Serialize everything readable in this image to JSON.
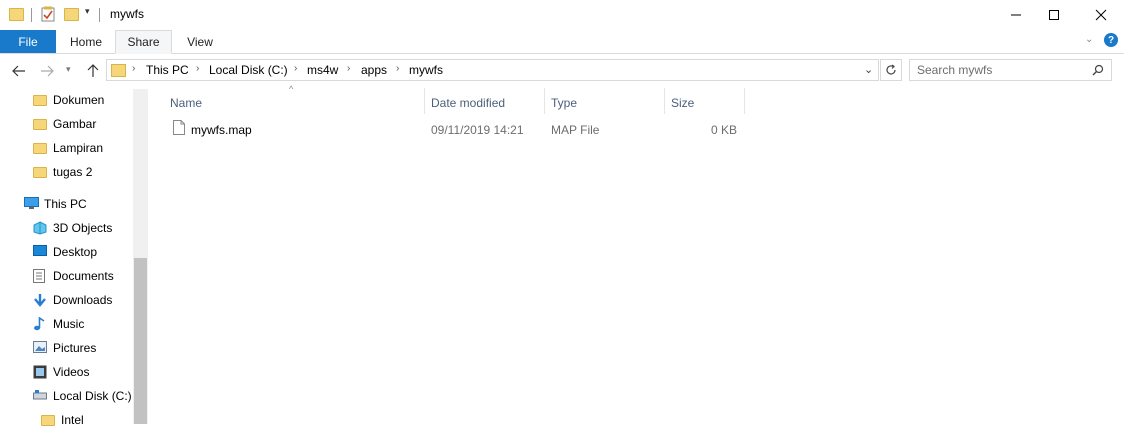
{
  "window": {
    "title": "mywfs"
  },
  "ribbon": {
    "tabs": [
      {
        "label": "File"
      },
      {
        "label": "Home"
      },
      {
        "label": "Share"
      },
      {
        "label": "View"
      }
    ]
  },
  "address": {
    "breadcrumb": [
      "This PC",
      "Local Disk (C:)",
      "ms4w",
      "apps",
      "mywfs"
    ]
  },
  "search": {
    "placeholder": "Search mywfs"
  },
  "nav": {
    "quick_access": [
      {
        "label": "Dokumen",
        "icon": "folder-icon"
      },
      {
        "label": "Gambar",
        "icon": "folder-icon"
      },
      {
        "label": "Lampiran",
        "icon": "folder-icon"
      },
      {
        "label": "tugas 2",
        "icon": "folder-icon"
      }
    ],
    "this_pc": {
      "label": "This PC",
      "icon": "computer-icon"
    },
    "pc_items": [
      {
        "label": "3D Objects",
        "icon": "3d-objects-icon"
      },
      {
        "label": "Desktop",
        "icon": "desktop-icon"
      },
      {
        "label": "Documents",
        "icon": "documents-icon"
      },
      {
        "label": "Downloads",
        "icon": "downloads-icon"
      },
      {
        "label": "Music",
        "icon": "music-icon"
      },
      {
        "label": "Pictures",
        "icon": "pictures-icon"
      },
      {
        "label": "Videos",
        "icon": "videos-icon"
      },
      {
        "label": "Local Disk (C:)",
        "icon": "drive-icon"
      }
    ],
    "sub_items": [
      {
        "label": "Intel",
        "icon": "folder-icon"
      }
    ]
  },
  "columns": {
    "name": "Name",
    "date": "Date modified",
    "type": "Type",
    "size": "Size"
  },
  "files": [
    {
      "name": "mywfs.map",
      "date": "09/11/2019 14:21",
      "type": "MAP File",
      "size": "0 KB"
    }
  ],
  "colors": {
    "accent": "#1979ca",
    "folder": "#f5d77a",
    "header_text": "#4c607a"
  }
}
